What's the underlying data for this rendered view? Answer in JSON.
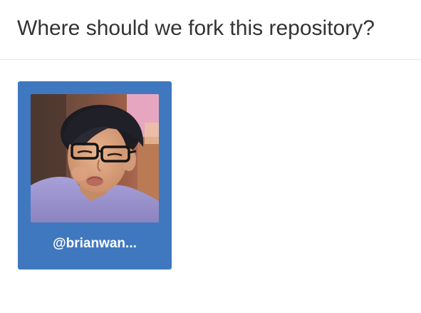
{
  "page": {
    "title": "Where should we fork this repository?"
  },
  "fork_targets": [
    {
      "username": "@brianwan...",
      "avatar_icon": "user-avatar-photo"
    }
  ],
  "colors": {
    "accent": "#4078c0",
    "text": "#333333",
    "divider": "#e1e4e8"
  }
}
